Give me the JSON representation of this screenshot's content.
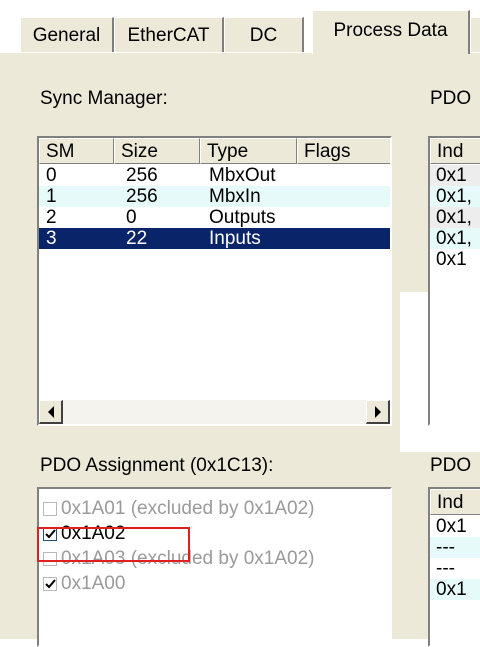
{
  "tabs": [
    "General",
    "EtherCAT",
    "DC",
    "Process Data"
  ],
  "sync_manager": {
    "label": "Sync Manager:",
    "columns": [
      "SM",
      "Size",
      "Type",
      "Flags"
    ],
    "rows": [
      {
        "sm": "0",
        "size": "256",
        "type": "MbxOut"
      },
      {
        "sm": "1",
        "size": "256",
        "type": "MbxIn"
      },
      {
        "sm": "2",
        "size": "0",
        "type": "Outputs"
      },
      {
        "sm": "3",
        "size": "22",
        "type": "Inputs"
      }
    ],
    "selected_index": 3
  },
  "pdo_list": {
    "label": "PDO",
    "column": "Ind",
    "rows": [
      "0x1",
      "0x1,",
      "0x1,",
      "0x1,",
      "0x1"
    ]
  },
  "pdo_assignment": {
    "label": "PDO Assignment (0x1C13):",
    "items": [
      {
        "text": "0x1A01 (excluded by 0x1A02)",
        "checked": false,
        "enabled": false
      },
      {
        "text": "0x1A02",
        "checked": true,
        "enabled": true
      },
      {
        "text": "0x1A03 (excluded by 0x1A02)",
        "checked": false,
        "enabled": false
      },
      {
        "text": "0x1A00",
        "checked": true,
        "enabled": false
      }
    ]
  },
  "pdo_content": {
    "label": "PDO",
    "column": "Ind",
    "rows": [
      "0x1",
      "---",
      "---",
      "0x1"
    ]
  },
  "colors": {
    "panel": "#ece9d8",
    "selection": "#0a246a",
    "alt_row": "#e6fafa",
    "highlight": "#e02020"
  }
}
